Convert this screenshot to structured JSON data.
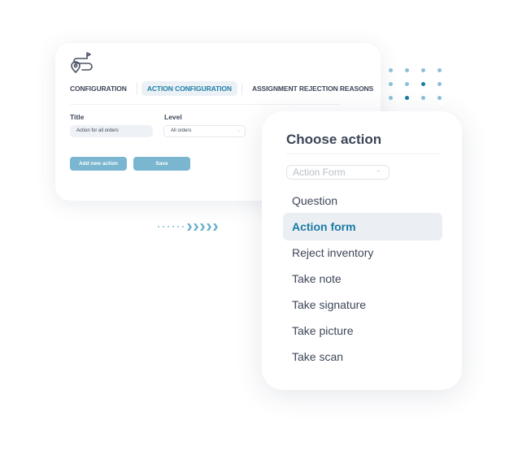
{
  "config_panel": {
    "logo_icon": "route-pin-flag-icon",
    "tabs": [
      {
        "label": "CONFIGURATION",
        "active": false
      },
      {
        "label": "ACTION CONFIGURATION",
        "active": true
      },
      {
        "label": "ASSIGNMENT REJECTION REASONS",
        "active": false
      }
    ],
    "title_label": "Title",
    "title_value": "Action for all orders",
    "level_label": "Level",
    "level_value": "All orders",
    "add_button": "Add new action",
    "save_button": "Save"
  },
  "choose_action": {
    "title": "Choose action",
    "select_value": "Action Form",
    "options": [
      {
        "label": "Question",
        "selected": false
      },
      {
        "label": "Action form",
        "selected": true
      },
      {
        "label": "Reject inventory",
        "selected": false
      },
      {
        "label": "Take note",
        "selected": false
      },
      {
        "label": "Take signature",
        "selected": false
      },
      {
        "label": "Take picture",
        "selected": false
      },
      {
        "label": "Take scan",
        "selected": false
      }
    ]
  },
  "colors": {
    "accent": "#1b7aa3",
    "button": "#7ab6cf",
    "text": "#3d4658",
    "selected_bg": "#ebeff4"
  }
}
